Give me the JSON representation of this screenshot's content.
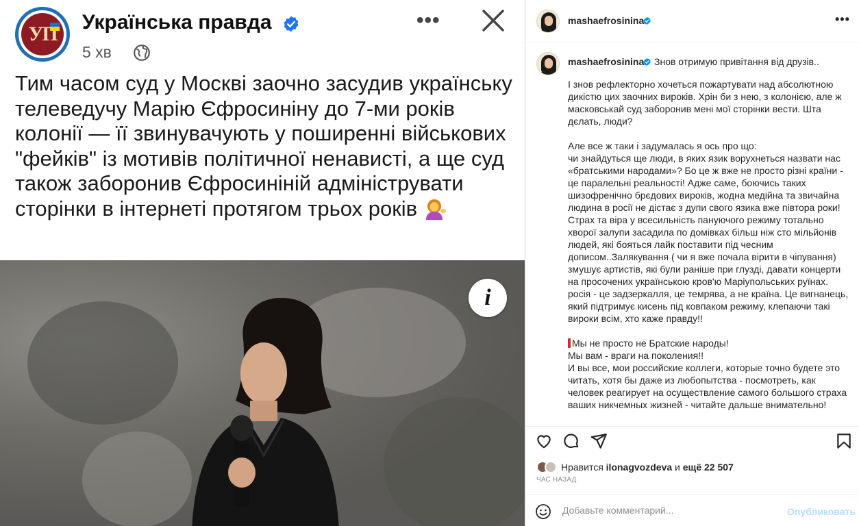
{
  "post_image": {
    "page_name": "Українська правда",
    "logo_text": "УП",
    "time": "5 хв",
    "icons": {
      "more": "more-horizontal-icon",
      "close": "close-icon",
      "globe": "globe-icon",
      "info": "info-icon"
    },
    "text": "Тим часом суд у Москві заочно засудив українську телеведучу Марію Єфросиніну до 7-ми років колонії — її звинувачують у поширенні військових \"фейків\" із мотивів політичної ненависті, а ще суд також заборонив Єфросиніній адмініструвати сторінки в інтернеті протягом трьох років",
    "info_glyph": "i"
  },
  "instagram": {
    "username": "mashaefrosinina",
    "header_more": "•••",
    "caption": {
      "first_line": "Знов отримую привітання від друзів..",
      "paragraphs": [
        "І знов рефлекторно хочеться пожартувати над абсолютною дикістю цих заочних вироків. Хрін би з нею, з колонією, але ж масковськай суд заборонив мені мої сторінки вести. Шта дєлать, люди?",
        "Але все ж таки і задумалась я ось про що:\nчи знайдуться ще люди, в яких язик ворухнеться назвати нас «братськими народами»? Бо це ж вже не просто різні країни - це паралельні реальності! Адже саме, боючись таких шизофренічно брєдових вироків, жодна медійна та звичайна людина в росії не дістає з дупи свого язика вже півтора роки! Страх та віра у всесильність пануючого режиму тотально хворої залупи засадила по домівках більш ніж сто мільйонів людей, які бояться лайк поставити під чесним дописом..Залякування ( чи я вже почала вірити в чіпування) змушує артистів, які були раніше при глузді, давати концерти на просочених українською кров'ю Маріупольських руїнах. росія - це задзеркалля, це темрява, а не країна. Це вигнанець, який підтримує кисень під ковпаком режиму, клепаючи такі вироки всім, хто каже правду!!"
      ],
      "russian_first": "Мы не просто не Братские народы!",
      "russian_rest": "Мы вам - враги на поколения!!\nИ вы все, мои российские коллеги, которые точно будете это читать, хотя бы даже из любопытства - посмотреть, как человек реагирует на осуществление самого большого страха ваших никчемных жизней - читайте дальше внимательно!"
    },
    "actions": {
      "like": "heart-icon",
      "comment": "comment-icon",
      "share": "share-icon",
      "save": "bookmark-icon"
    },
    "likes": {
      "prefix": "Нравится",
      "user": "ilonagvozdeva",
      "middle": "и",
      "rest": "ещё 22 507"
    },
    "time_ago": "ЧАС НАЗАД",
    "comment": {
      "placeholder": "Добавьте комментарий...",
      "publish": "Опубликовать"
    },
    "colors": {
      "verified": "#0095f6",
      "publish_disabled": "#b2dffc",
      "mark": "#e0232e"
    }
  }
}
